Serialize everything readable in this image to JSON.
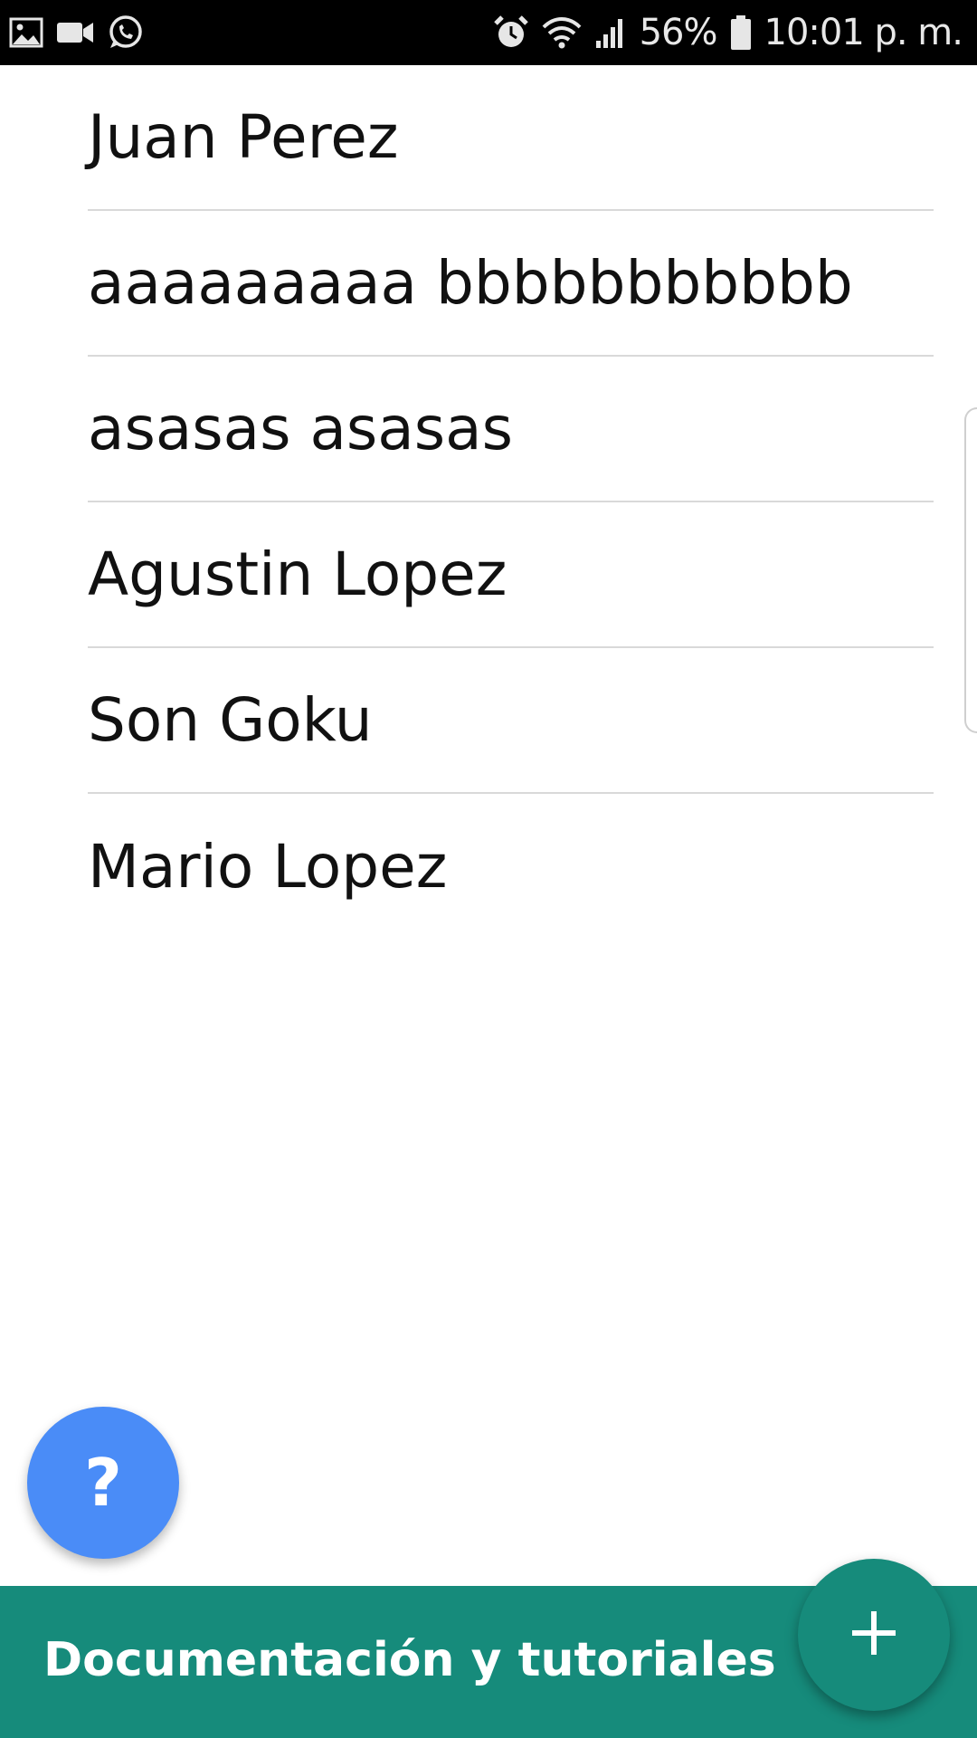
{
  "status_bar": {
    "battery": "56%",
    "time": "10:01 p. m.",
    "left_icons": [
      "gallery-icon",
      "video-camera-icon",
      "whatsapp-icon"
    ],
    "right_icons": [
      "alarm-icon",
      "wifi-icon",
      "signal-icon",
      "battery-icon"
    ]
  },
  "contacts": [
    "Juan Perez",
    "aaaaaaaaa bbbbbbbbbbb",
    "asasas asasas",
    "Agustin Lopez",
    "Son Goku",
    "Mario Lopez"
  ],
  "help_fab": {
    "label": "?"
  },
  "bottom_bar": {
    "label": "Documentación y tutoriales"
  },
  "add_fab": {
    "icon": "plus-icon"
  },
  "colors": {
    "accent_teal": "#168b7b",
    "help_blue": "#4a8cf7",
    "divider": "#d9d9d9"
  }
}
